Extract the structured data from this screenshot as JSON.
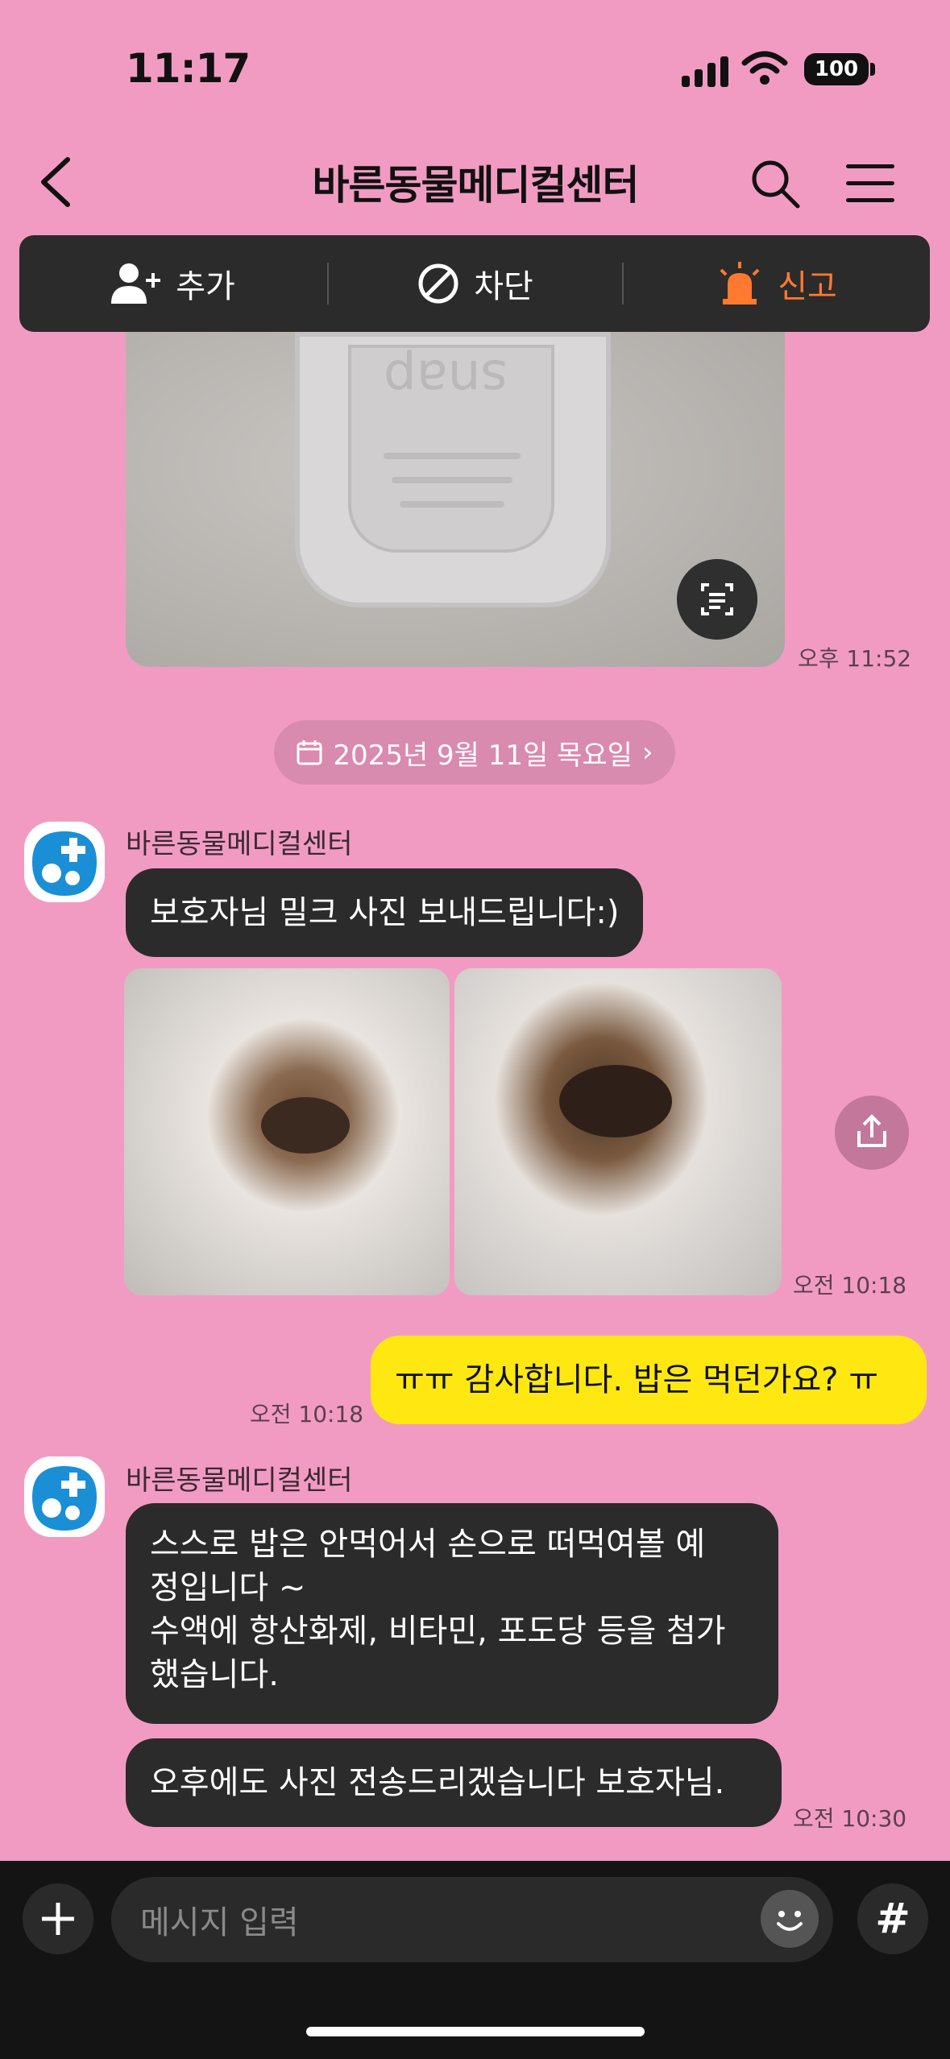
{
  "status_bar": {
    "time": "11:17",
    "battery": "100"
  },
  "header": {
    "title": "바른동물메디컬센터"
  },
  "action_bar": {
    "add_label": "추가",
    "block_label": "차단",
    "report_label": "신고"
  },
  "messages": {
    "photo_time": "오후 11:52",
    "date_divider": "2025년 9월 11일 목요일",
    "sender_1": "바른동물메디컬센터",
    "msg_1": "보호자님 밀크 사진 보내드립니다:)",
    "photos_time": "오전 10:18",
    "my_msg": "ㅠㅠ 감사합니다. 밥은 먹던가요? ㅠ",
    "my_msg_time": "오전 10:18",
    "sender_2": "바른동물메디컬센터",
    "msg_2_line1": "스스로 밥은 안먹어서 손으로 떠먹여볼 예",
    "msg_2_line2": "정입니다 ~",
    "msg_2_line3": "수액에 항산화제, 비타민, 포도당 등을 첨가",
    "msg_2_line4": "했습니다.",
    "msg_3": "오후에도 사진 전송드리겠습니다 보호자님.",
    "msg_3_time": "오전 10:30"
  },
  "input": {
    "placeholder": "메시지 입력",
    "hashtag": "#"
  },
  "colors": {
    "background": "#f29bc2",
    "bubble_other": "#2b2b2b",
    "bubble_mine": "#ffe812",
    "report_accent": "#ff7a2f"
  }
}
